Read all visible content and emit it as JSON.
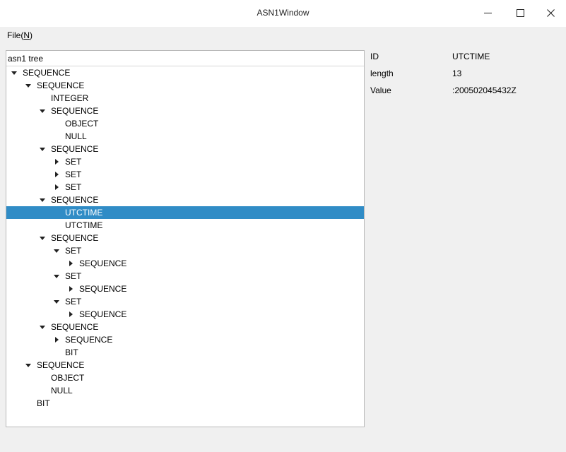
{
  "window": {
    "title": "ASN1Window",
    "minimize_glyph": "—",
    "maximize_glyph": "☐",
    "close_glyph": "✕"
  },
  "menu": {
    "file_prefix": "File(",
    "file_accel": "N",
    "file_suffix": ")"
  },
  "tree": {
    "header": "asn1 tree",
    "nodes": [
      {
        "label": "SEQUENCE",
        "depth": 0,
        "state": "expanded"
      },
      {
        "label": "SEQUENCE",
        "depth": 1,
        "state": "expanded"
      },
      {
        "label": "INTEGER",
        "depth": 2,
        "state": "leaf"
      },
      {
        "label": "SEQUENCE",
        "depth": 2,
        "state": "expanded"
      },
      {
        "label": "OBJECT",
        "depth": 3,
        "state": "leaf"
      },
      {
        "label": "NULL",
        "depth": 3,
        "state": "leaf"
      },
      {
        "label": "SEQUENCE",
        "depth": 2,
        "state": "expanded"
      },
      {
        "label": "SET",
        "depth": 3,
        "state": "collapsed"
      },
      {
        "label": "SET",
        "depth": 3,
        "state": "collapsed"
      },
      {
        "label": "SET",
        "depth": 3,
        "state": "collapsed"
      },
      {
        "label": "SEQUENCE",
        "depth": 2,
        "state": "expanded"
      },
      {
        "label": "UTCTIME",
        "depth": 3,
        "state": "leaf",
        "selected": true
      },
      {
        "label": "UTCTIME",
        "depth": 3,
        "state": "leaf"
      },
      {
        "label": "SEQUENCE",
        "depth": 2,
        "state": "expanded"
      },
      {
        "label": "SET",
        "depth": 3,
        "state": "expanded"
      },
      {
        "label": "SEQUENCE",
        "depth": 4,
        "state": "collapsed"
      },
      {
        "label": "SET",
        "depth": 3,
        "state": "expanded"
      },
      {
        "label": "SEQUENCE",
        "depth": 4,
        "state": "collapsed"
      },
      {
        "label": "SET",
        "depth": 3,
        "state": "expanded"
      },
      {
        "label": "SEQUENCE",
        "depth": 4,
        "state": "collapsed"
      },
      {
        "label": "SEQUENCE",
        "depth": 2,
        "state": "expanded"
      },
      {
        "label": "SEQUENCE",
        "depth": 3,
        "state": "collapsed"
      },
      {
        "label": "BIT",
        "depth": 3,
        "state": "leaf"
      },
      {
        "label": "SEQUENCE",
        "depth": 1,
        "state": "expanded"
      },
      {
        "label": "OBJECT",
        "depth": 2,
        "state": "leaf"
      },
      {
        "label": "NULL",
        "depth": 2,
        "state": "leaf"
      },
      {
        "label": "BIT",
        "depth": 1,
        "state": "leaf"
      }
    ]
  },
  "details": {
    "rows": [
      {
        "key": "ID",
        "value": "UTCTIME"
      },
      {
        "key": "length",
        "value": "13"
      },
      {
        "key": "Value",
        "value": ":200502045432Z"
      }
    ]
  },
  "colors": {
    "selection": "#308cc6",
    "selection_text": "#ffffff"
  }
}
